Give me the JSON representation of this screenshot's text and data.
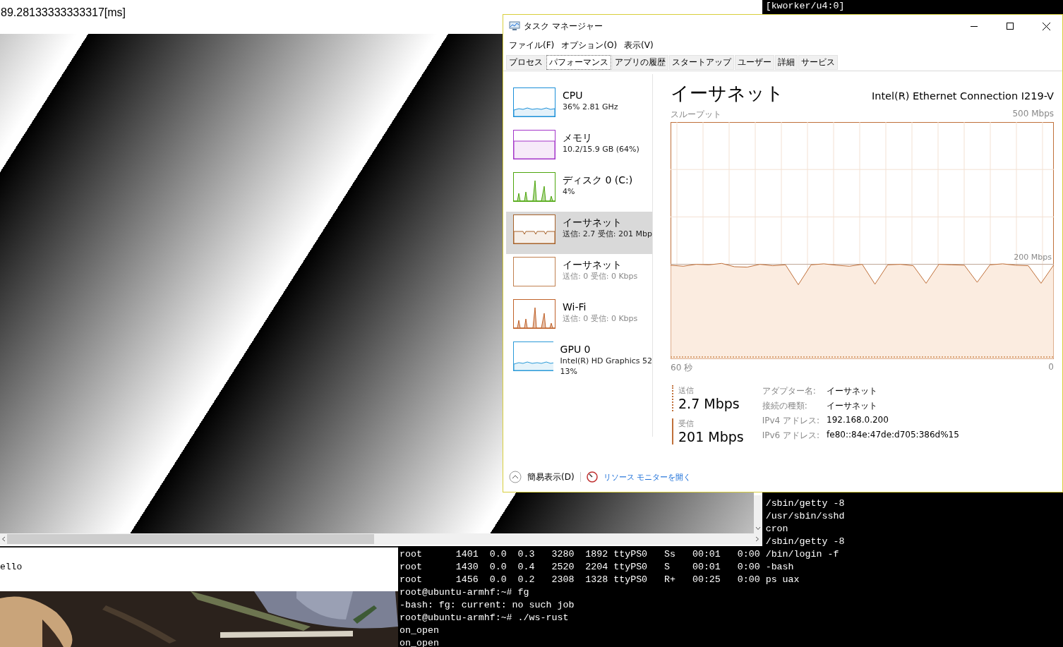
{
  "browser": {
    "timing": "89.28133333333317[ms]"
  },
  "terminal": {
    "top_lines": [
      {
        "kind": "command",
        "text": "[kworker/u4:0]"
      }
    ],
    "lines": [
      {
        "kind": "command",
        "text": "/sbin/getty -8"
      },
      {
        "kind": "command",
        "text": "/usr/sbin/sshd"
      },
      {
        "kind": "command",
        "text": "cron"
      },
      {
        "kind": "command",
        "text": "/sbin/getty -8"
      },
      {
        "kind": "full",
        "text": "root      1401  0.0  0.3   3280  1892 ttyPS0   Ss   00:01   0:00 /bin/login -f"
      },
      {
        "kind": "full",
        "text": "root      1430  0.0  0.4   2520  2204 ttyPS0   S    00:01   0:00 -bash"
      },
      {
        "kind": "full",
        "text": "root      1456  0.0  0.2   2308  1328 ttyPS0   R+   00:25   0:00 ps uax"
      },
      {
        "kind": "full",
        "text": "root@ubuntu-armhf:~# fg"
      },
      {
        "kind": "full",
        "text": "-bash: fg: current: no such job"
      },
      {
        "kind": "full",
        "text": "root@ubuntu-armhf:~# ./ws-rust"
      },
      {
        "kind": "full",
        "text": "on_open"
      },
      {
        "kind": "full",
        "text": "on_open"
      }
    ]
  },
  "editor": {
    "text": "ello"
  },
  "task_manager": {
    "window": {
      "title": "タスク マネージャー"
    },
    "menu": [
      "ファイル(F)",
      "オプション(O)",
      "表示(V)"
    ],
    "tabs": [
      {
        "label": "プロセス",
        "selected": false
      },
      {
        "label": "パフォーマンス",
        "selected": true
      },
      {
        "label": "アプリの履歴",
        "selected": false
      },
      {
        "label": "スタートアップ",
        "selected": false
      },
      {
        "label": "ユーザー",
        "selected": false
      },
      {
        "label": "詳細",
        "selected": false
      },
      {
        "label": "サービス",
        "selected": false
      }
    ],
    "sidebar": {
      "items": [
        {
          "kind": "line",
          "color": "#1a8fd8",
          "title": "CPU",
          "lines": [
            "36% 2.81 GHz"
          ],
          "dimmed": false,
          "selected": false
        },
        {
          "kind": "flat",
          "color": "#a335c9",
          "title": "メモリ",
          "lines": [
            "10.2/15.9 GB (64%)"
          ],
          "dimmed": false,
          "selected": false
        },
        {
          "kind": "spikes",
          "color": "#4da60c",
          "title": "ディスク 0 (C:)",
          "lines": [
            "4%"
          ],
          "dimmed": false,
          "selected": false
        },
        {
          "kind": "band",
          "color": "#a7622a",
          "title": "イーサネット",
          "lines": [
            "送信: 2.7 受信: 201 Mbp"
          ],
          "dimmed": false,
          "selected": true
        },
        {
          "kind": "empty",
          "color": "#c08050",
          "title": "イーサネット",
          "lines": [
            "送信: 0 受信: 0 Kbps"
          ],
          "dimmed": true,
          "selected": false
        },
        {
          "kind": "spikes",
          "color": "#c0622a",
          "title": "Wi-Fi",
          "lines": [
            "送信: 0 受信: 0 Kbps"
          ],
          "dimmed": true,
          "selected": false
        },
        {
          "kind": "line",
          "color": "#2a9ad8",
          "title": "GPU 0",
          "lines": [
            "Intel(R) HD Graphics 52",
            "13%"
          ],
          "dimmed": false,
          "selected": false
        }
      ]
    },
    "detail": {
      "title": "イーサネット",
      "adapter": "Intel(R) Ethernet Connection I219-V",
      "throughput": {
        "label": "スループット",
        "max": "500 Mbps",
        "mark": "200 Mbps",
        "start": "60 秒",
        "end": "0"
      },
      "stats": [
        {
          "label": "送信",
          "value": "2.7 Mbps",
          "kind": "dotted"
        },
        {
          "label": "受信",
          "value": "201 Mbps",
          "kind": "solid"
        }
      ],
      "properties": [
        {
          "label": "アダプター名:",
          "value": "イーサネット"
        },
        {
          "label": "接続の種類:",
          "value": "イーサネット"
        },
        {
          "label": "IPv4 アドレス:",
          "value": "192.168.0.200"
        },
        {
          "label": "IPv6 アドレス:",
          "value": "fe80::84e:47de:d705:386d%15"
        }
      ]
    },
    "footer": {
      "fewer_details": "簡易表示(D)",
      "link": "リソース モニターを開く"
    }
  }
}
